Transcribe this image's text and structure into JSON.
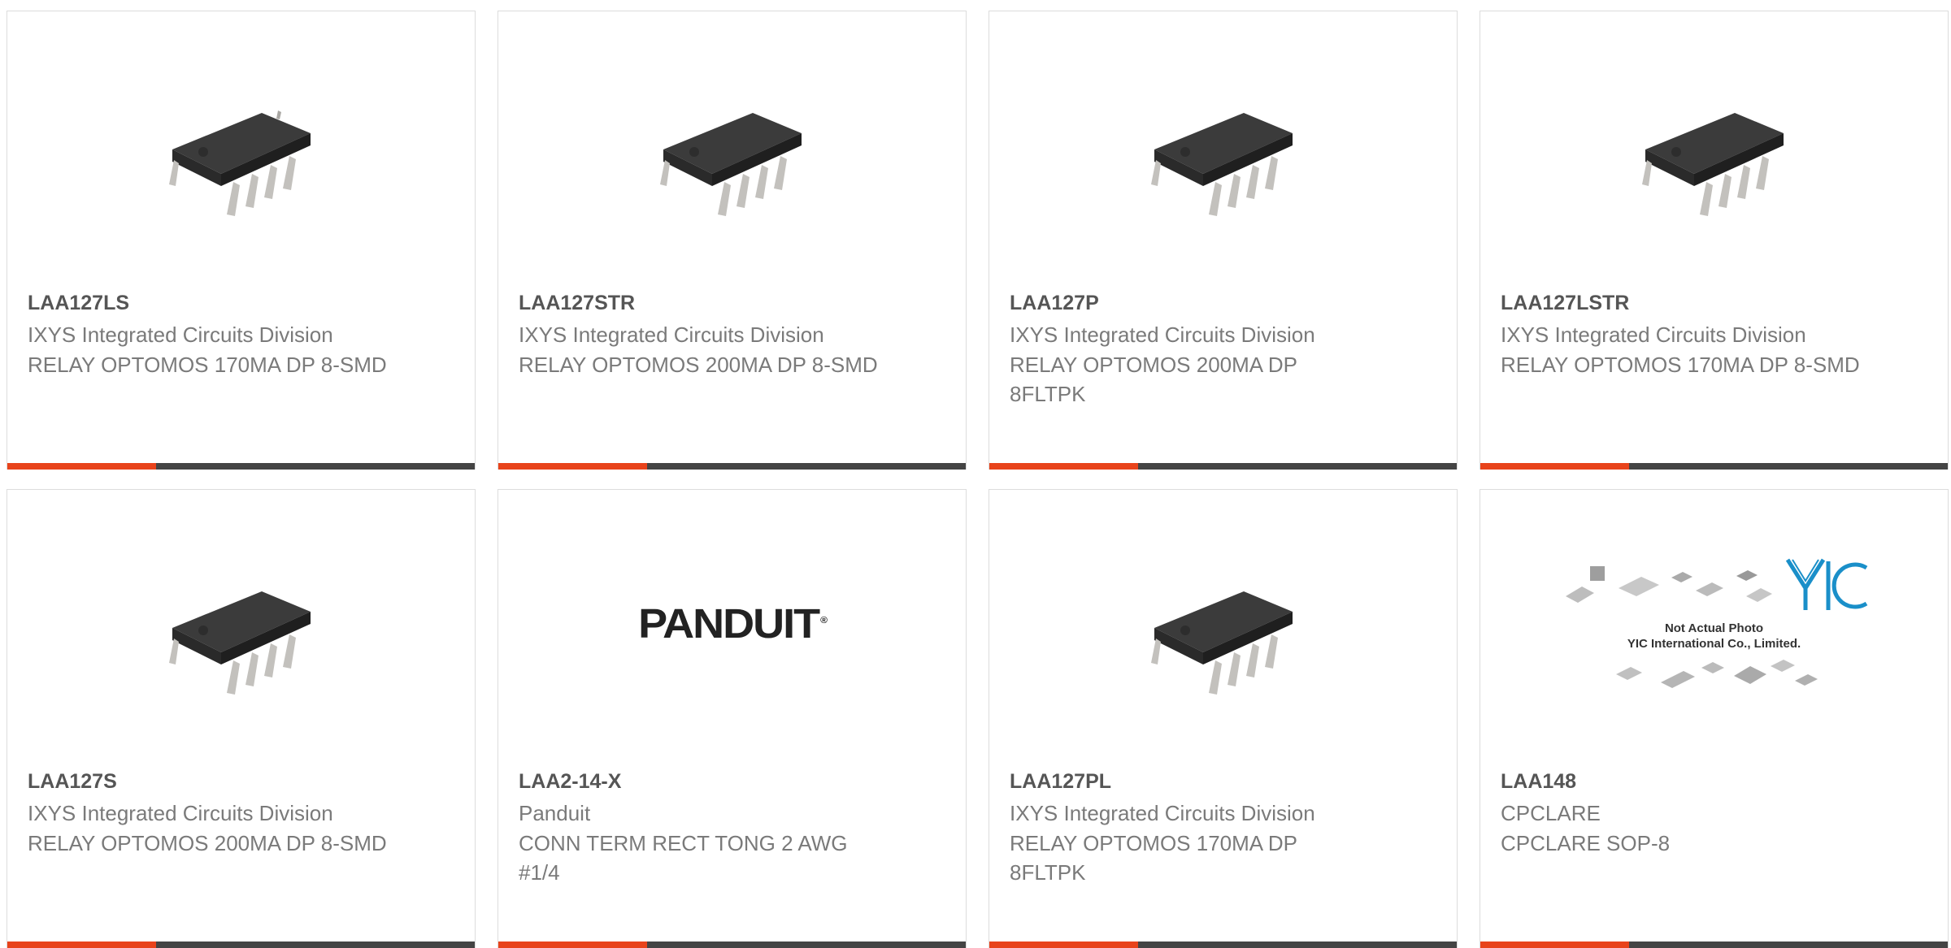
{
  "accent_color": "#e8431b",
  "bar_color": "#444444",
  "products": [
    {
      "part": "LAA127LS",
      "manufacturer": "IXYS Integrated Circuits Division",
      "description": "RELAY OPTOMOS 170MA DP 8-SMD",
      "image": "chip"
    },
    {
      "part": "LAA127STR",
      "manufacturer": "IXYS Integrated Circuits Division",
      "description": "RELAY OPTOMOS 200MA DP 8-SMD",
      "image": "chip"
    },
    {
      "part": "LAA127P",
      "manufacturer": "IXYS Integrated Circuits Division",
      "description": "RELAY OPTOMOS 200MA DP 8FLTPK",
      "image": "chip"
    },
    {
      "part": "LAA127LSTR",
      "manufacturer": "IXYS Integrated Circuits Division",
      "description": "RELAY OPTOMOS 170MA DP 8-SMD",
      "image": "chip"
    },
    {
      "part": "LAA127S",
      "manufacturer": "IXYS Integrated Circuits Division",
      "description": "RELAY OPTOMOS 200MA DP 8-SMD",
      "image": "chip"
    },
    {
      "part": "LAA2-14-X",
      "manufacturer": "Panduit",
      "description": "CONN TERM RECT TONG 2 AWG #1/4",
      "image": "panduit-logo"
    },
    {
      "part": "LAA127PL",
      "manufacturer": "IXYS Integrated Circuits Division",
      "description": "RELAY OPTOMOS 170MA DP 8FLTPK",
      "image": "chip"
    },
    {
      "part": "LAA148",
      "manufacturer": "CPCLARE",
      "description": "CPCLARE SOP-8",
      "image": "yic-placeholder"
    }
  ],
  "logos": {
    "panduit": "PANDUIT",
    "yic_line1": "Not Actual Photo",
    "yic_line2": "YIC International Co., Limited."
  }
}
